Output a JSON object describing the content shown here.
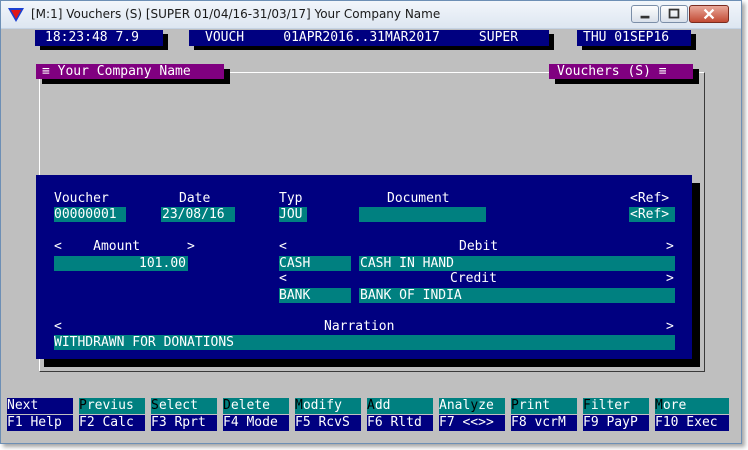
{
  "window": {
    "title": "[M:1]  Vouchers (S)  [SUPER  01/04/16-31/03/17]  Your Company Name"
  },
  "status_bar": {
    "time_version": "18:23:48 7.9",
    "mode_period": "VOUCH     01APR2016..31MAR2017     SUPER",
    "day_date": "THU 01SEP16"
  },
  "frame": {
    "company_box": "≡ Your Company Name",
    "screen_box": "Vouchers (S) ≡"
  },
  "form": {
    "voucher_label": "Voucher",
    "voucher_value": "00000001",
    "date_label": "Date",
    "date_value": "23/08/16",
    "type_label": "Typ",
    "type_value": "JOU",
    "document_label": "Document",
    "document_value": "",
    "ref_label": "<Ref>",
    "ref_value": "<Ref>",
    "amount_label": "<    Amount      >",
    "amount_value": "101.00",
    "debit_label_left": "<",
    "debit_label": "Debit",
    "debit_label_right": ">",
    "debit_code": "CASH",
    "debit_name": "CASH IN HAND",
    "credit_label_left": "<",
    "credit_label": "Credit",
    "credit_label_right": ">",
    "credit_code": "BANK",
    "credit_name": "BANK OF INDIA",
    "narration_label_left": "<",
    "narration_label": "Narration",
    "narration_label_right": ">",
    "narration_value": "WITHDRAWN FOR DONATIONS"
  },
  "function_keys": [
    {
      "top_hot": "",
      "top_rest": "Next",
      "bottom": "F1 Help"
    },
    {
      "top_hot": "P",
      "top_rest": "revius",
      "bottom": "F2 Calc"
    },
    {
      "top_hot": "S",
      "top_rest": "elect",
      "bottom": "F3 Rprt"
    },
    {
      "top_hot": "D",
      "top_rest": "elete",
      "bottom": "F4 Mode"
    },
    {
      "top_hot": "M",
      "top_rest": "odify",
      "bottom": "F5 RcvS"
    },
    {
      "top_hot": "A",
      "top_rest": "dd",
      "bottom": "F6 Rltd"
    },
    {
      "top_pre": "Anal",
      "top_hot": "y",
      "top_rest": "ze",
      "bottom": "F7 <<>>"
    },
    {
      "top_hot": "P",
      "top_rest": "rint",
      "bottom": "F8 vcrM"
    },
    {
      "top_hot": "F",
      "top_rest": "ilter",
      "bottom": "F9 PayP"
    },
    {
      "top_hot": "M",
      "top_rest": "ore",
      "bottom": "F10 Exec"
    }
  ],
  "colors": {
    "background": "#bfbfbf",
    "panel_blue": "#000080",
    "field_teal": "#008080",
    "title_purple": "#800080"
  }
}
